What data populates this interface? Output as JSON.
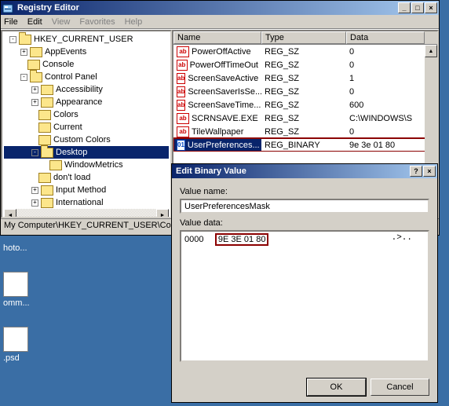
{
  "window": {
    "title": "Registry Editor",
    "min": "_",
    "max": "□",
    "close": "×"
  },
  "menu": [
    "File",
    "Edit",
    "View",
    "Favorites",
    "Help"
  ],
  "tree": {
    "root": "HKEY_CURRENT_USER",
    "n1": "AppEvents",
    "n2": "Console",
    "n3": "Control Panel",
    "n3a": "Accessibility",
    "n3b": "Appearance",
    "n3c": "Colors",
    "n3d": "Current",
    "n3e": "Custom Colors",
    "n3f": "Desktop",
    "n3f1": "WindowMetrics",
    "n3g": "don't load",
    "n3h": "Input Method",
    "n3i": "International"
  },
  "list": {
    "headers": {
      "name": "Name",
      "type": "Type",
      "data": "Data"
    },
    "rows": [
      {
        "icon": "str",
        "name": "PowerOffActive",
        "type": "REG_SZ",
        "data": "0"
      },
      {
        "icon": "str",
        "name": "PowerOffTimeOut",
        "type": "REG_SZ",
        "data": "0"
      },
      {
        "icon": "str",
        "name": "ScreenSaveActive",
        "type": "REG_SZ",
        "data": "1"
      },
      {
        "icon": "str",
        "name": "ScreenSaverIsSe...",
        "type": "REG_SZ",
        "data": "0"
      },
      {
        "icon": "str",
        "name": "ScreenSaveTime...",
        "type": "REG_SZ",
        "data": "600"
      },
      {
        "icon": "str",
        "name": "SCRNSAVE.EXE",
        "type": "REG_SZ",
        "data": "C:\\WINDOWS\\S"
      },
      {
        "icon": "str",
        "name": "TileWallpaper",
        "type": "REG_SZ",
        "data": "0"
      },
      {
        "icon": "bin",
        "name": "UserPreferences...",
        "type": "REG_BINARY",
        "data": "9e 3e 01 80"
      }
    ]
  },
  "statusbar": "My Computer\\HKEY_CURRENT_USER\\Contr",
  "dialog": {
    "title": "Edit Binary Value",
    "help": "?",
    "close": "×",
    "vname_label": "Value name:",
    "vname_value": "UserPreferencesMask",
    "vdata_label": "Value data:",
    "hex_offset": "0000",
    "hex_bytes": "9E 3E 01 80",
    "hex_ascii": ".>..",
    "ok": "OK",
    "cancel": "Cancel"
  },
  "desktop": {
    "i1": "hoto...",
    "i2": "omm...",
    "i3": ".psd"
  }
}
